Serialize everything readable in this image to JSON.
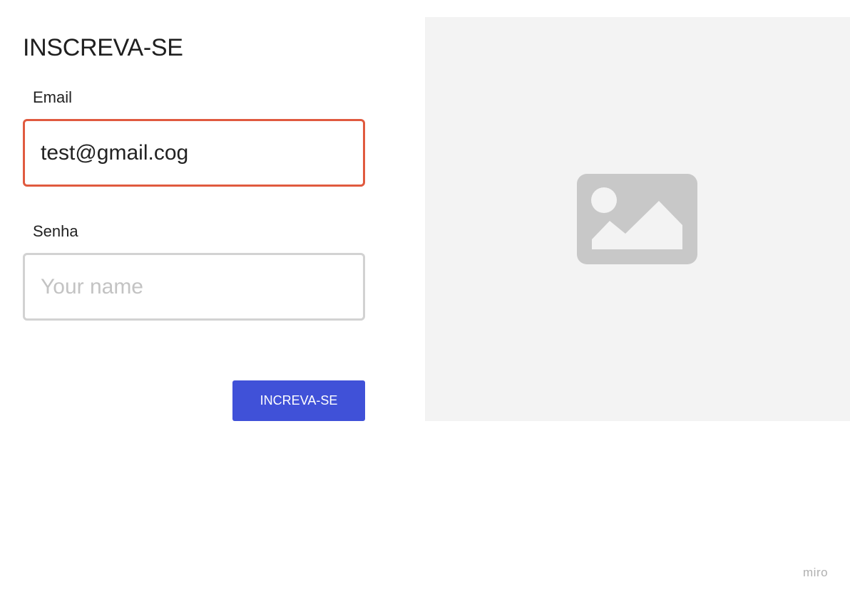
{
  "form": {
    "title": "INSCREVA-SE",
    "email_label": "Email",
    "email_value": "test@gmail.cog",
    "email_border_color": "#e05a3f",
    "password_label": "Senha",
    "password_value": "",
    "password_placeholder": "Your name",
    "submit_label": "INCREVA-SE",
    "submit_color": "#4051d8"
  },
  "image_placeholder": {
    "icon": "image-icon"
  },
  "watermark": "miro"
}
